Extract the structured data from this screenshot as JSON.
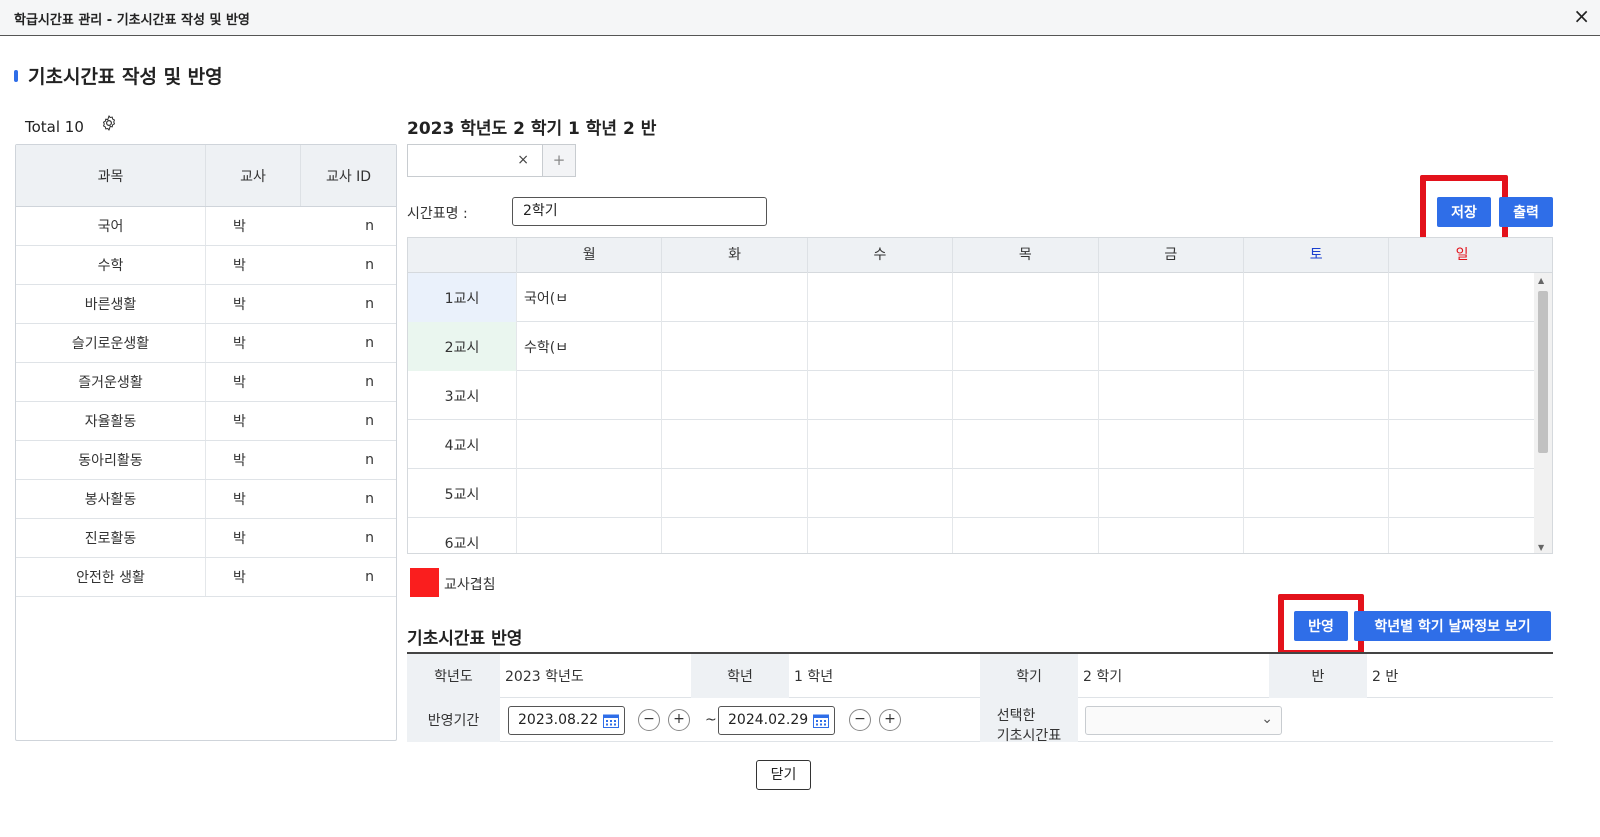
{
  "window": {
    "title": "학급시간표 관리 - 기초시간표 작성 및 반영",
    "close_icon": "×"
  },
  "page": {
    "title": "기초시간표 작성 및 반영"
  },
  "subject_list": {
    "total_label": "Total 10",
    "headers": [
      "과목",
      "교사",
      "교사 ID"
    ],
    "rows": [
      {
        "subject": "국어",
        "teacher": "박",
        "teacher_id": "n"
      },
      {
        "subject": "수학",
        "teacher": "박",
        "teacher_id": "n"
      },
      {
        "subject": "바른생활",
        "teacher": "박",
        "teacher_id": "n"
      },
      {
        "subject": "슬기로운생활",
        "teacher": "박",
        "teacher_id": "n"
      },
      {
        "subject": "즐거운생활",
        "teacher": "박",
        "teacher_id": "n"
      },
      {
        "subject": "자율활동",
        "teacher": "박",
        "teacher_id": "n"
      },
      {
        "subject": "동아리활동",
        "teacher": "박",
        "teacher_id": "n"
      },
      {
        "subject": "봉사활동",
        "teacher": "박",
        "teacher_id": "n"
      },
      {
        "subject": "진로활동",
        "teacher": "박",
        "teacher_id": "n"
      },
      {
        "subject": "안전한 생활",
        "teacher": "박",
        "teacher_id": "n"
      }
    ]
  },
  "timetable": {
    "year_title": "2023 학년도 2 학기 1 학년 2 반",
    "tab_input_value": "",
    "tab_clear": "×",
    "tab_add": "+",
    "name_label": "시간표명 :",
    "name_value": "2학기",
    "save_label": "저장",
    "print_label": "출력",
    "days": [
      "월",
      "화",
      "수",
      "목",
      "금",
      "토",
      "일"
    ],
    "periods": [
      {
        "label": "1교시",
        "cells": [
          "국어(ㅂ",
          "",
          "",
          "",
          "",
          "",
          ""
        ]
      },
      {
        "label": "2교시",
        "cells": [
          "수학(ㅂ",
          "",
          "",
          "",
          "",
          "",
          ""
        ]
      },
      {
        "label": "3교시",
        "cells": [
          "",
          "",
          "",
          "",
          "",
          "",
          ""
        ]
      },
      {
        "label": "4교시",
        "cells": [
          "",
          "",
          "",
          "",
          "",
          "",
          ""
        ]
      },
      {
        "label": "5교시",
        "cells": [
          "",
          "",
          "",
          "",
          "",
          "",
          ""
        ]
      },
      {
        "label": "6교시",
        "cells": [
          "",
          "",
          "",
          "",
          "",
          "",
          ""
        ]
      }
    ],
    "legend_label": "교사겹침",
    "colors": {
      "accent": "#2f6ee8",
      "conflict": "#fa1e1e",
      "highlight_box": "#e3121b",
      "saturday": "#1a3fcf",
      "sunday": "#e3121b"
    }
  },
  "apply": {
    "title": "기초시간표 반영",
    "apply_label": "반영",
    "view_dates_label": "학년별 학기 날짜정보 보기",
    "year_label": "학년도",
    "year_value": "2023 학년도",
    "grade_label": "학년",
    "grade_value": "1 학년",
    "semester_label": "학기",
    "semester_value": "2 학기",
    "class_label": "반",
    "class_value": "2 반",
    "period_label": "반영기간",
    "start_date": "2023.08.22",
    "end_date": "2024.02.29",
    "tilde": "~",
    "minus": "−",
    "plus": "+",
    "selected_label": "선택한\n기초시간표",
    "selected_value": ""
  },
  "footer": {
    "close_label": "닫기"
  }
}
